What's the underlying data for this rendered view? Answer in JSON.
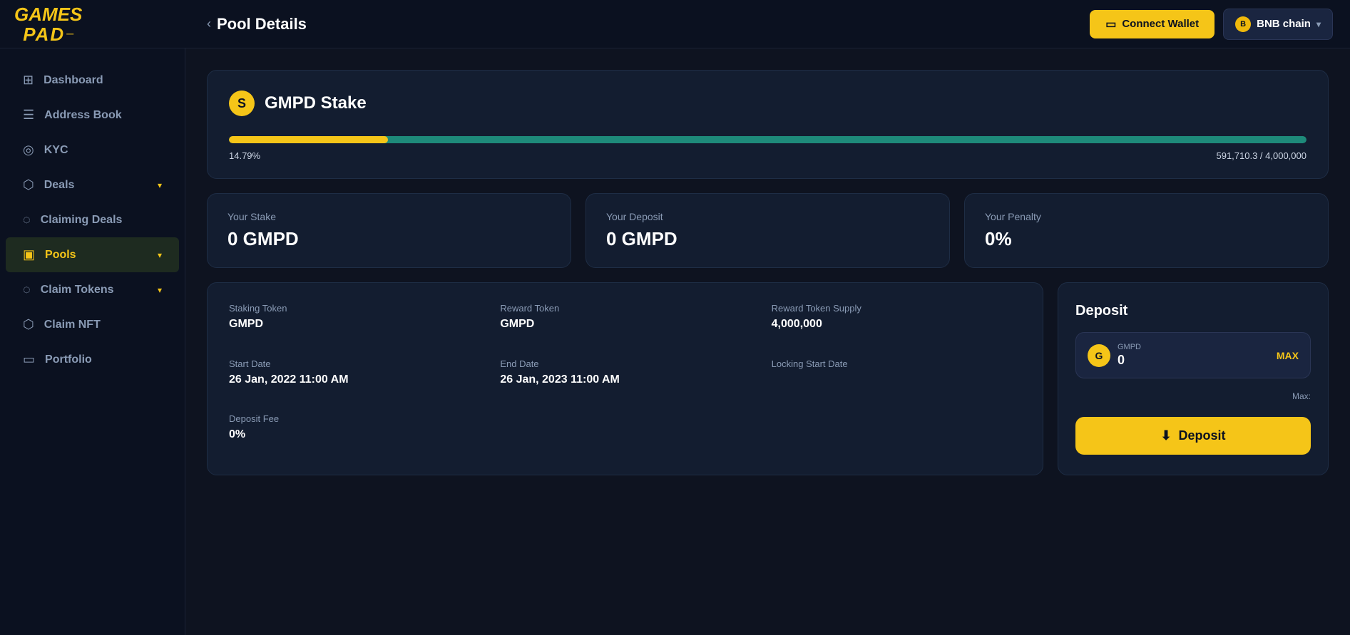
{
  "header": {
    "logo": {
      "top": "GAMES",
      "bottom": "PAD"
    },
    "page_title": "Pool Details",
    "back_label": "‹",
    "connect_wallet_label": "Connect Wallet",
    "network_label": "BNB chain"
  },
  "sidebar": {
    "items": [
      {
        "id": "dashboard",
        "label": "Dashboard",
        "icon": "⊞",
        "active": false
      },
      {
        "id": "address-book",
        "label": "Address Book",
        "icon": "☰",
        "active": false
      },
      {
        "id": "kyc",
        "label": "KYC",
        "icon": "◎",
        "active": false
      },
      {
        "id": "deals",
        "label": "Deals",
        "icon": "⬡",
        "active": false,
        "has_chevron": true
      },
      {
        "id": "claiming-deals",
        "label": "Claiming Deals",
        "icon": "◌",
        "active": false
      },
      {
        "id": "pools",
        "label": "Pools",
        "icon": "▣",
        "active": true,
        "has_chevron": true
      },
      {
        "id": "claim-tokens",
        "label": "Claim Tokens",
        "icon": "◌",
        "active": false,
        "has_chevron": true
      },
      {
        "id": "claim-nft",
        "label": "Claim NFT",
        "icon": "⬡",
        "active": false
      },
      {
        "id": "portfolio",
        "label": "Portfolio",
        "icon": "▭",
        "active": false
      }
    ]
  },
  "pool": {
    "name": "GMPD Stake",
    "icon_letter": "S",
    "progress": {
      "yellow_pct": 14.79,
      "teal_pct": 100,
      "yellow_pct_label": "14.79%",
      "amount_label": "591,710.3 / 4,000,000"
    },
    "stats": [
      {
        "label": "Your Stake",
        "value": "0 GMPD"
      },
      {
        "label": "Your Deposit",
        "value": "0 GMPD"
      },
      {
        "label": "Your Penalty",
        "value": "0%"
      }
    ],
    "details": [
      {
        "label": "Staking Token",
        "value": "GMPD"
      },
      {
        "label": "Reward Token",
        "value": "GMPD"
      },
      {
        "label": "Reward Token Supply",
        "value": "4,000,000"
      },
      {
        "label": "Start Date",
        "value": "26 Jan, 2022 11:00 AM"
      },
      {
        "label": "End Date",
        "value": "26 Jan, 2023 11:00 AM"
      },
      {
        "label": "Locking Start Date",
        "value": ""
      },
      {
        "label": "Deposit Fee",
        "value": "0%"
      },
      {
        "label": "",
        "value": ""
      },
      {
        "label": "",
        "value": ""
      }
    ],
    "deposit": {
      "title": "Deposit",
      "token_label": "GMPD",
      "input_value": "0",
      "max_label": "MAX",
      "max_info": "Max:",
      "button_label": "Deposit",
      "button_icon": "⬇"
    }
  }
}
